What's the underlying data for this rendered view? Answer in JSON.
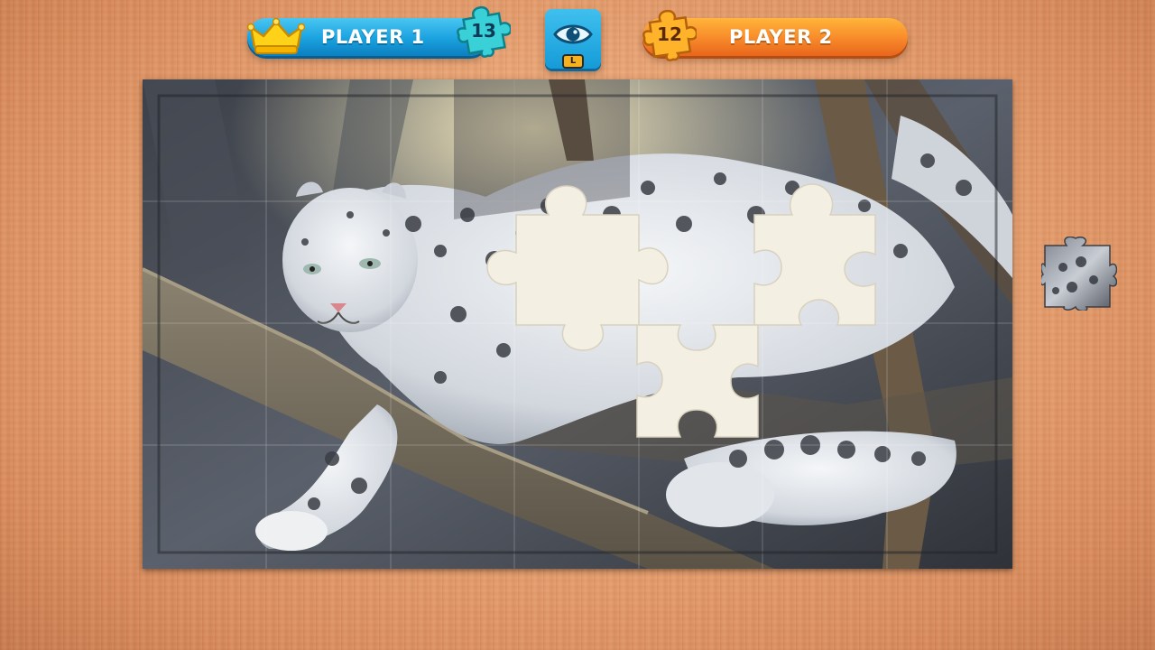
{
  "hud": {
    "player1": {
      "name": "PLAYER 1",
      "score": "13",
      "color": "#1aa1df",
      "badge_icon": "crown-icon"
    },
    "player2": {
      "name": "PLAYER 2",
      "score": "12",
      "color": "#f7892a"
    },
    "preview_button": {
      "icon": "eye-icon",
      "key_hint": "L"
    }
  },
  "board": {
    "image_subject": "snow-leopard-on-branch",
    "missing_pieces": 3,
    "loose_pieces": 1
  },
  "colors": {
    "table_wood": "#e9a272",
    "player1_blue": "#1aa1df",
    "player2_orange": "#f7892a",
    "empty_slot": "#f2eee2"
  }
}
